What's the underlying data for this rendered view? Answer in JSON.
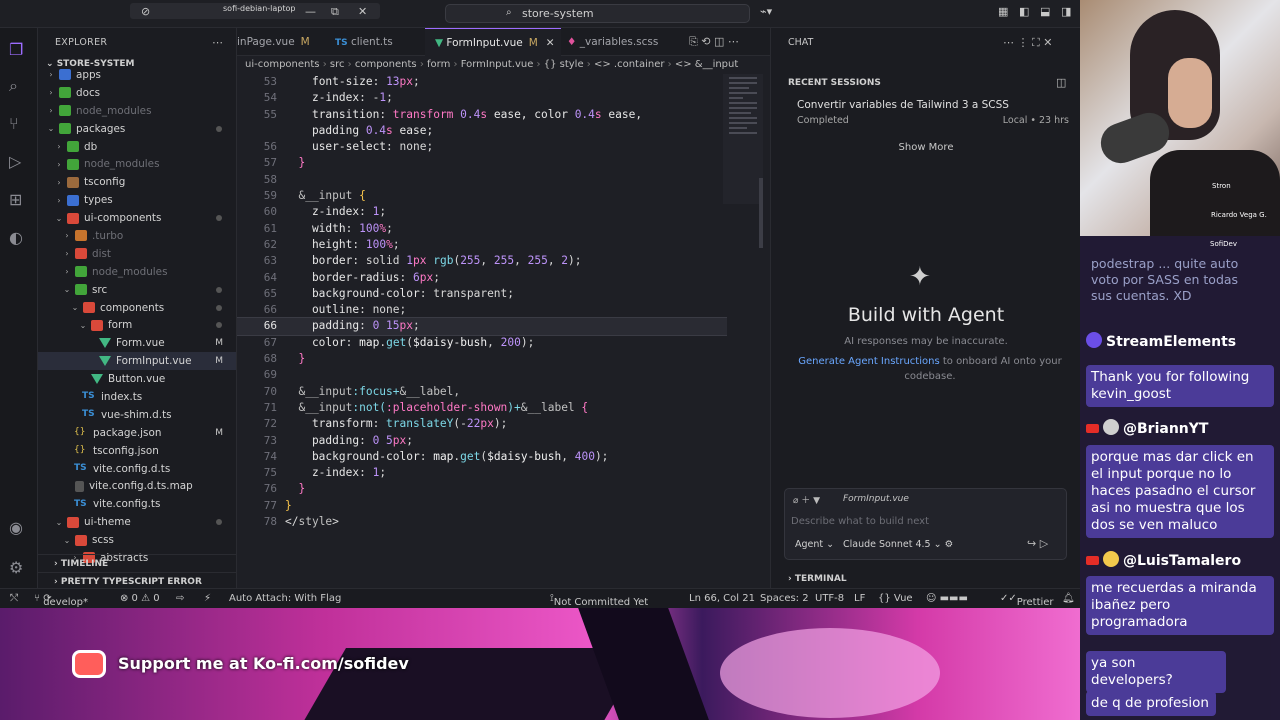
{
  "window": {
    "host": "sofi-debian-laptop",
    "search": "store-system"
  },
  "sidebar": {
    "header": "EXPLORER",
    "section": "STORE-SYSTEM",
    "items": [
      {
        "label": "apps",
        "depth": 1,
        "icon": "f-blue",
        "chev": "›"
      },
      {
        "label": "docs",
        "depth": 1,
        "icon": "f-green",
        "chev": "›"
      },
      {
        "label": "node_modules",
        "depth": 1,
        "icon": "f-green",
        "chev": "›",
        "dim": true
      },
      {
        "label": "packages",
        "depth": 1,
        "icon": "f-green",
        "chev": "⌄",
        "dot": true
      },
      {
        "label": "db",
        "depth": 2,
        "icon": "f-green",
        "chev": "›"
      },
      {
        "label": "node_modules",
        "depth": 2,
        "icon": "f-green",
        "chev": "›",
        "dim": true
      },
      {
        "label": "tsconfig",
        "depth": 2,
        "icon": "f-brown",
        "chev": "›"
      },
      {
        "label": "types",
        "depth": 2,
        "icon": "f-blue",
        "chev": "›"
      },
      {
        "label": "ui-components",
        "depth": 2,
        "icon": "f-red",
        "chev": "⌄",
        "dot": true
      },
      {
        "label": ".turbo",
        "depth": 3,
        "icon": "f-orange",
        "chev": "›",
        "dim": true
      },
      {
        "label": "dist",
        "depth": 3,
        "icon": "f-red",
        "chev": "›",
        "dim": true
      },
      {
        "label": "node_modules",
        "depth": 3,
        "icon": "f-green",
        "chev": "›",
        "dim": true
      },
      {
        "label": "src",
        "depth": 3,
        "icon": "f-green",
        "chev": "⌄",
        "dot": true
      },
      {
        "label": "components",
        "depth": 4,
        "icon": "f-red",
        "chev": "⌄",
        "dot": true
      },
      {
        "label": "form",
        "depth": 5,
        "icon": "f-red",
        "chev": "⌄",
        "dot": true
      },
      {
        "label": "Form.vue",
        "depth": 6,
        "icon": "vue",
        "chev": "",
        "mark": "M"
      },
      {
        "label": "FormInput.vue",
        "depth": 6,
        "icon": "vue",
        "chev": "",
        "mark": "M",
        "sel": true
      },
      {
        "label": "Button.vue",
        "depth": 5,
        "icon": "vue",
        "chev": ""
      },
      {
        "label": "index.ts",
        "depth": 4,
        "icon": "ts",
        "chev": ""
      },
      {
        "label": "vue-shim.d.ts",
        "depth": 4,
        "icon": "ts",
        "chev": ""
      },
      {
        "label": "package.json",
        "depth": 3,
        "icon": "json",
        "chev": "",
        "mark": "M"
      },
      {
        "label": "tsconfig.json",
        "depth": 3,
        "icon": "json",
        "chev": ""
      },
      {
        "label": "vite.config.d.ts",
        "depth": 3,
        "icon": "ts",
        "chev": ""
      },
      {
        "label": "vite.config.d.ts.map",
        "depth": 3,
        "icon": "map",
        "chev": ""
      },
      {
        "label": "vite.config.ts",
        "depth": 3,
        "icon": "ts",
        "chev": ""
      },
      {
        "label": "ui-theme",
        "depth": 2,
        "icon": "f-red",
        "chev": "⌄",
        "dot": true
      },
      {
        "label": "scss",
        "depth": 3,
        "icon": "f-red",
        "chev": "⌄"
      },
      {
        "label": "abstracts",
        "depth": 4,
        "icon": "f-red",
        "chev": "›"
      }
    ],
    "timeline": "TIMELINE",
    "pretty_errors": "PRETTY TYPESCRIPT ERROR"
  },
  "tabs": [
    {
      "label": "inPage.vue",
      "icon": "",
      "mod": "M"
    },
    {
      "label": "client.ts",
      "icon": "TS",
      "mod": ""
    },
    {
      "label": "FormInput.vue",
      "icon": "▼",
      "mod": "M",
      "active": true
    },
    {
      "label": "_variables.scss",
      "icon": "♦",
      "mod": ""
    }
  ],
  "breadcrumb": [
    "ui-components",
    "src",
    "components",
    "form",
    "FormInput.vue",
    "{} style",
    "<> .container",
    "<> &__input"
  ],
  "code": [
    {
      "n": "53",
      "parts": [
        [
          "    ",
          "c-prop"
        ],
        [
          "font-size",
          "c-prop"
        ],
        [
          ": ",
          "c-punc"
        ],
        [
          "13",
          "c-num"
        ],
        [
          "px",
          "c-kw"
        ],
        [
          ";",
          "c-punc"
        ]
      ]
    },
    {
      "n": "54",
      "parts": [
        [
          "    ",
          "c-prop"
        ],
        [
          "z-index",
          "c-prop"
        ],
        [
          ": -",
          "c-punc"
        ],
        [
          "1",
          "c-num"
        ],
        [
          ";",
          "c-punc"
        ]
      ]
    },
    {
      "n": "55",
      "parts": [
        [
          "    ",
          "c-prop"
        ],
        [
          "transition",
          "c-prop"
        ],
        [
          ": ",
          "c-punc"
        ],
        [
          "transform ",
          "c-kw"
        ],
        [
          "0.4",
          "c-num"
        ],
        [
          "s",
          "c-kw"
        ],
        [
          " ease, color ",
          "c-prop"
        ],
        [
          "0.4",
          "c-num"
        ],
        [
          "s",
          "c-kw"
        ],
        [
          " ease,",
          "c-prop"
        ]
      ]
    },
    {
      "n": "",
      "parts": [
        [
          "    padding ",
          "c-prop"
        ],
        [
          "0.4",
          "c-num"
        ],
        [
          "s",
          "c-kw"
        ],
        [
          " ease;",
          "c-prop"
        ]
      ]
    },
    {
      "n": "56",
      "parts": [
        [
          "    ",
          "c-prop"
        ],
        [
          "user-select",
          "c-prop"
        ],
        [
          ": none;",
          "c-punc"
        ]
      ]
    },
    {
      "n": "57",
      "parts": [
        [
          "  }",
          "c-kw"
        ]
      ]
    },
    {
      "n": "58",
      "parts": [
        [
          "",
          "c-prop"
        ]
      ]
    },
    {
      "n": "59",
      "parts": [
        [
          "  &__input ",
          "c-sel"
        ],
        [
          "{",
          "c-br"
        ]
      ]
    },
    {
      "n": "60",
      "parts": [
        [
          "    z-index",
          "c-prop"
        ],
        [
          ": ",
          "c-punc"
        ],
        [
          "1",
          "c-num"
        ],
        [
          ";",
          "c-punc"
        ]
      ]
    },
    {
      "n": "61",
      "parts": [
        [
          "    width",
          "c-prop"
        ],
        [
          ": ",
          "c-punc"
        ],
        [
          "100",
          "c-num"
        ],
        [
          "%",
          "c-kw"
        ],
        [
          ";",
          "c-punc"
        ]
      ]
    },
    {
      "n": "62",
      "parts": [
        [
          "    height",
          "c-prop"
        ],
        [
          ": ",
          "c-punc"
        ],
        [
          "100",
          "c-num"
        ],
        [
          "%",
          "c-kw"
        ],
        [
          ";",
          "c-punc"
        ]
      ]
    },
    {
      "n": "63",
      "parts": [
        [
          "    border",
          "c-prop"
        ],
        [
          ": solid ",
          "c-punc"
        ],
        [
          "1",
          "c-num"
        ],
        [
          "px ",
          "c-kw"
        ],
        [
          "rgb",
          "c-fn"
        ],
        [
          "(",
          "c-punc"
        ],
        [
          "255",
          "c-num"
        ],
        [
          ", ",
          "c-punc"
        ],
        [
          "255",
          "c-num"
        ],
        [
          ", ",
          "c-punc"
        ],
        [
          "255",
          "c-num"
        ],
        [
          ", ",
          "c-punc"
        ],
        [
          "2",
          "c-num"
        ],
        [
          ");",
          "c-punc"
        ]
      ]
    },
    {
      "n": "64",
      "parts": [
        [
          "    border-radius",
          "c-prop"
        ],
        [
          ": ",
          "c-punc"
        ],
        [
          "6",
          "c-num"
        ],
        [
          "px",
          "c-kw"
        ],
        [
          ";",
          "c-punc"
        ]
      ]
    },
    {
      "n": "65",
      "parts": [
        [
          "    background-color",
          "c-prop"
        ],
        [
          ": transparent;",
          "c-punc"
        ]
      ]
    },
    {
      "n": "66",
      "parts": [
        [
          "    outline",
          "c-prop"
        ],
        [
          ": none;",
          "c-punc"
        ]
      ]
    },
    {
      "n": "66",
      "parts": [
        [
          "    padding",
          "c-prop"
        ],
        [
          ": ",
          "c-punc"
        ],
        [
          "0 15",
          "c-num"
        ],
        [
          "px",
          "c-kw"
        ],
        [
          ";",
          "c-punc"
        ]
      ],
      "cur": true
    },
    {
      "n": "67",
      "parts": [
        [
          "    color",
          "c-prop"
        ],
        [
          ": ",
          "c-punc"
        ],
        [
          "map",
          "c-var"
        ],
        [
          ".",
          "c-punc"
        ],
        [
          "get",
          "c-fn"
        ],
        [
          "(",
          "c-punc"
        ],
        [
          "$daisy-bush",
          "c-var"
        ],
        [
          ", ",
          "c-punc"
        ],
        [
          "200",
          "c-num"
        ],
        [
          ");",
          "c-punc"
        ]
      ]
    },
    {
      "n": "68",
      "parts": [
        [
          "  }",
          "c-kw"
        ]
      ]
    },
    {
      "n": "69",
      "parts": [
        [
          "",
          "c-prop"
        ]
      ]
    },
    {
      "n": "70",
      "parts": [
        [
          "  &__input",
          "c-sel"
        ],
        [
          ":focus+",
          "c-fn"
        ],
        [
          "&__label,",
          "c-sel"
        ]
      ]
    },
    {
      "n": "71",
      "parts": [
        [
          "  &__input",
          "c-sel"
        ],
        [
          ":not(",
          "c-fn"
        ],
        [
          ":placeholder-shown",
          "c-kw"
        ],
        [
          ")+",
          "c-fn"
        ],
        [
          "&__label ",
          "c-sel"
        ],
        [
          "{",
          "c-kw"
        ]
      ]
    },
    {
      "n": "72",
      "parts": [
        [
          "    transform",
          "c-prop"
        ],
        [
          ": ",
          "c-punc"
        ],
        [
          "translateY",
          "c-fn"
        ],
        [
          "(-",
          "c-punc"
        ],
        [
          "22",
          "c-num"
        ],
        [
          "px",
          "c-kw"
        ],
        [
          ");",
          "c-punc"
        ]
      ]
    },
    {
      "n": "73",
      "parts": [
        [
          "    padding",
          "c-prop"
        ],
        [
          ": ",
          "c-punc"
        ],
        [
          "0 5",
          "c-num"
        ],
        [
          "px",
          "c-kw"
        ],
        [
          ";",
          "c-punc"
        ]
      ]
    },
    {
      "n": "74",
      "parts": [
        [
          "    background-color",
          "c-prop"
        ],
        [
          ": ",
          "c-punc"
        ],
        [
          "map",
          "c-var"
        ],
        [
          ".",
          "c-punc"
        ],
        [
          "get",
          "c-fn"
        ],
        [
          "(",
          "c-punc"
        ],
        [
          "$daisy-bush",
          "c-var"
        ],
        [
          ", ",
          "c-punc"
        ],
        [
          "400",
          "c-num"
        ],
        [
          ");",
          "c-punc"
        ]
      ]
    },
    {
      "n": "75",
      "parts": [
        [
          "    z-index",
          "c-prop"
        ],
        [
          ": ",
          "c-punc"
        ],
        [
          "1",
          "c-num"
        ],
        [
          ";",
          "c-punc"
        ]
      ]
    },
    {
      "n": "76",
      "parts": [
        [
          "  }",
          "c-kw"
        ]
      ]
    },
    {
      "n": "77",
      "parts": [
        [
          "}",
          "c-br"
        ]
      ]
    },
    {
      "n": "78",
      "parts": [
        [
          "</",
          "c-punc"
        ],
        [
          "style",
          "c-sel"
        ],
        [
          ">",
          "c-punc"
        ]
      ]
    }
  ],
  "chat": {
    "title": "CHAT",
    "recent": "RECENT SESSIONS",
    "session_title": "Convertir variables de Tailwind 3 a SCSS",
    "session_status": "Completed",
    "session_time": "Local • 23 hrs",
    "show_more": "Show More",
    "heading": "Build with Agent",
    "warning": "AI responses may be inaccurate.",
    "gen_link": "Generate Agent Instructions",
    "gen_rest": " to onboard AI onto your codebase.",
    "file": "FormInput.vue",
    "placeholder": "Describe what to build next",
    "mode": "Agent",
    "model": "Claude Sonnet 4.5",
    "terminal": "TERMINAL"
  },
  "status": {
    "branch": "develop*",
    "problems": "⊗ 0 ⚠ 0",
    "attach": "Auto Attach: With Flag",
    "commit": "Not Committed Yet",
    "pos": "Ln 66, Col 21",
    "spaces": "Spaces: 2",
    "enc": "UTF-8",
    "eol": "LF",
    "lang": "{} Vue",
    "prettier": "Prettier"
  },
  "webcam": {
    "tag1": "Stron",
    "tag2": "Ricardo Vega G.",
    "tag3": "SofiDev"
  },
  "stream": {
    "faded": "podestrap ... quite auto voto por SASS en todas sus cuentas. XD",
    "se_name": "StreamElements",
    "se_msg": "Thank you for following kevin_goost",
    "u1": "@BriannYT",
    "m1": "porque mas dar click en el input porque no lo haces pasadno el cursor asi no muestra que los dos se ven maluco",
    "u2": "@LuisTamalero",
    "m2": "me recuerdas a miranda ibañez pero programadora",
    "m3": "ya son developers?",
    "m4": "de q de profesion"
  },
  "banner": {
    "kofi": "Support me at Ko-fi.com/sofidev"
  }
}
